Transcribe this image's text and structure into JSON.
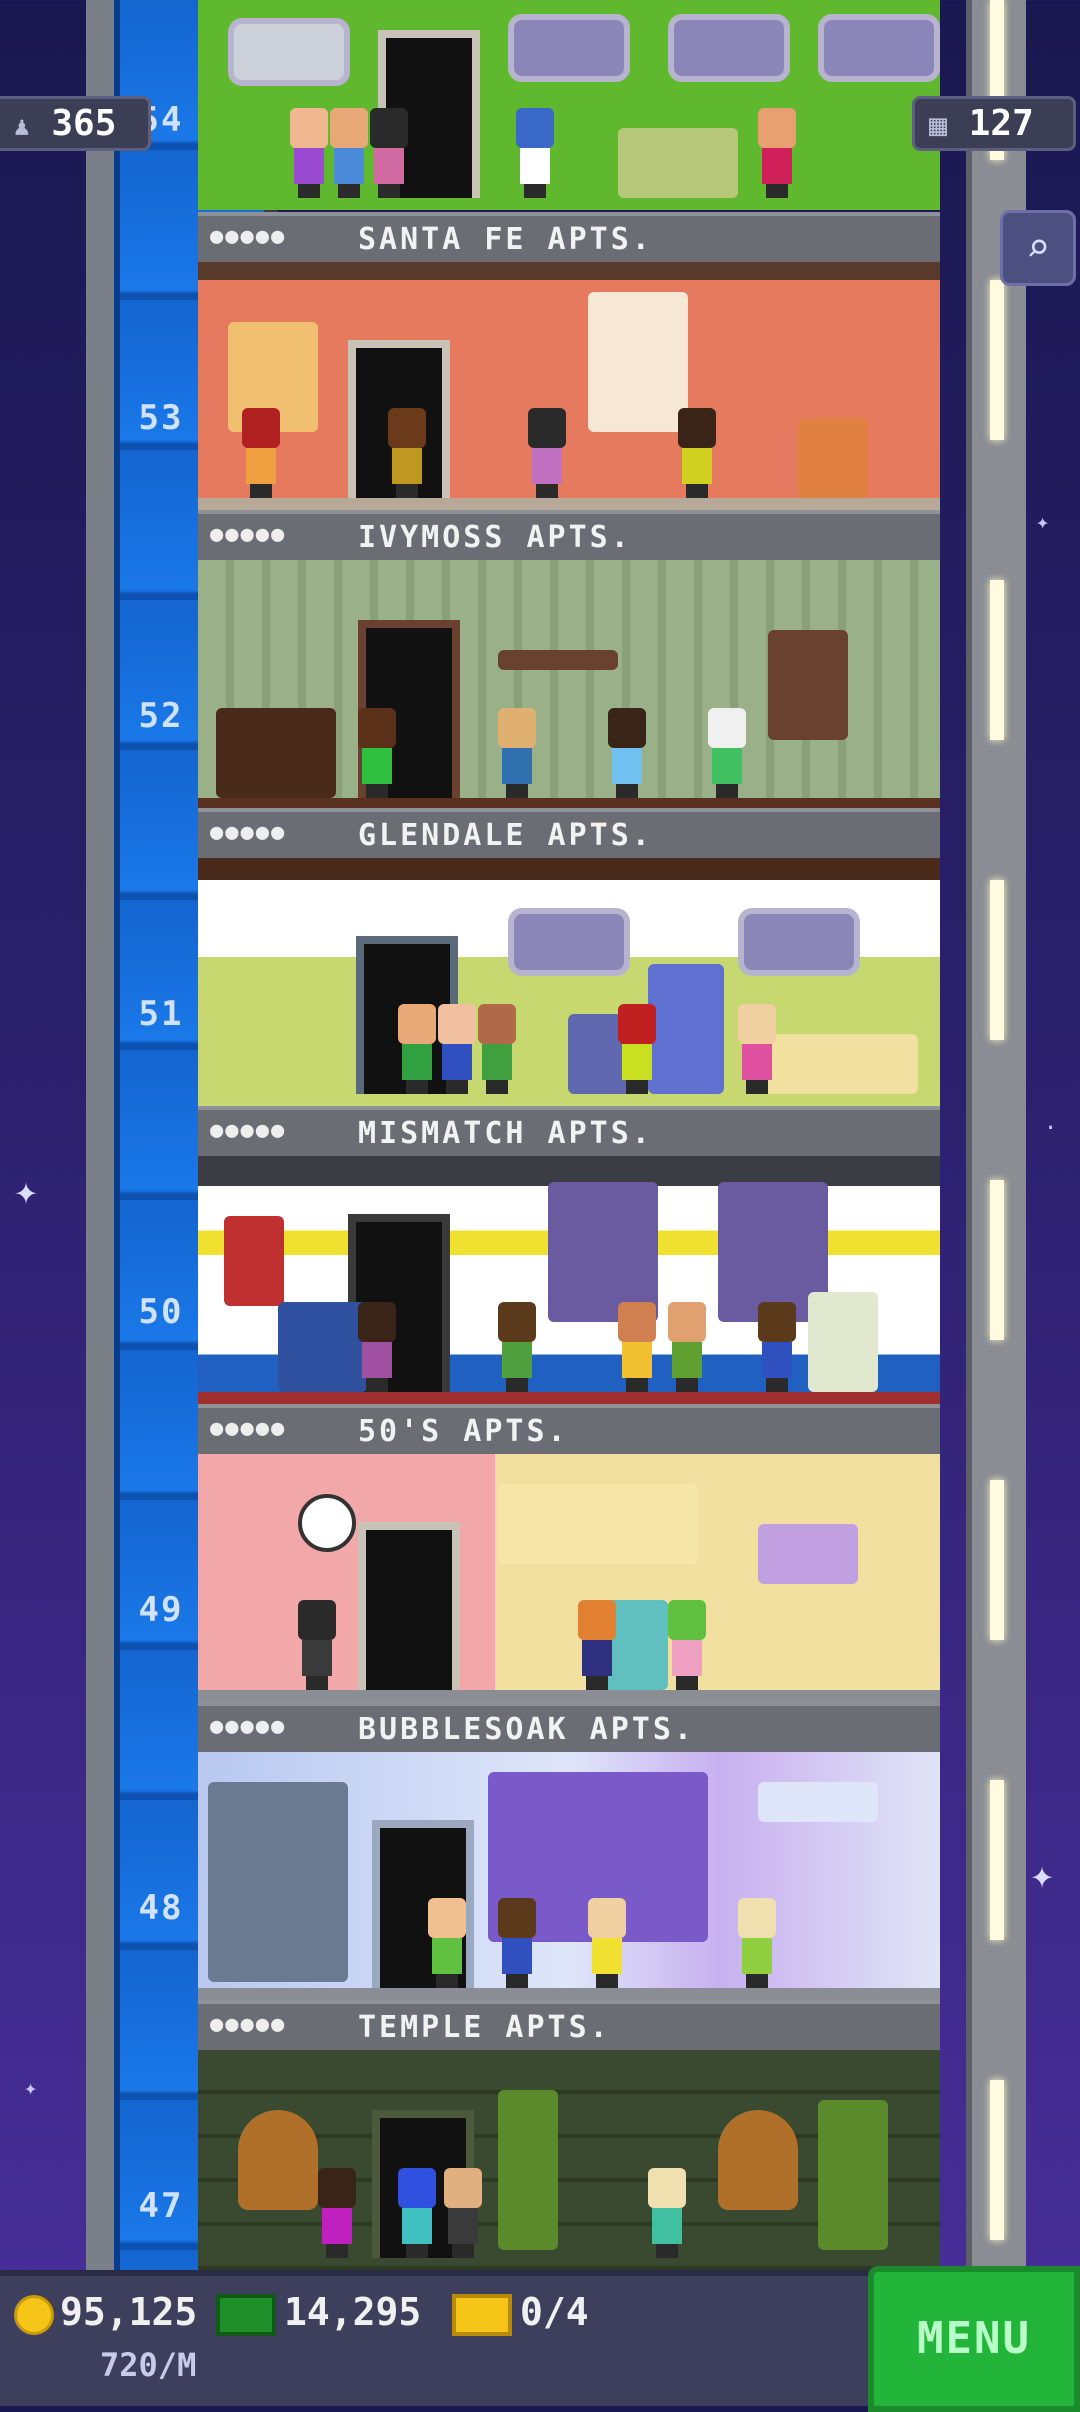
{
  "hud": {
    "population": "365",
    "rooms": "127",
    "coins": "95,125",
    "coin_rate": "720/M",
    "bux": "14,295",
    "tickets": "0/4",
    "menu_label": "MENU",
    "search_icon": "magnifier-icon"
  },
  "floors": [
    {
      "number": "54",
      "name": ""
    },
    {
      "number": "53",
      "name": "SANTA FE APTS."
    },
    {
      "number": "52",
      "name": "IVYMOSS APTS."
    },
    {
      "number": "51",
      "name": "GLENDALE APTS."
    },
    {
      "number": "50",
      "name": "MISMATCH APTS."
    },
    {
      "number": "49",
      "name": "50'S APTS."
    },
    {
      "number": "48",
      "name": "BUBBLESOAK APTS."
    },
    {
      "number": "47",
      "name": "TEMPLE APTS."
    }
  ],
  "residents_marker": "●●●●●",
  "colors": {
    "shaft_blue": "#1a78e8",
    "menu_green": "#23b53a"
  }
}
